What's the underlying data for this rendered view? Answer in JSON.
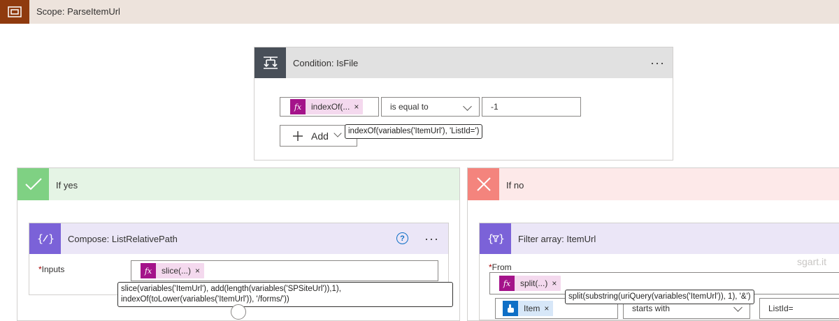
{
  "scope": {
    "title": "Scope: ParseItemUrl"
  },
  "condition": {
    "title": "Condition: IsFile",
    "menu": "···",
    "left_token": "indexOf(...",
    "operator": "is equal to",
    "value": "-1",
    "add_label": "Add",
    "tooltip": "indexOf(variables('ItemUrl'), 'ListId=')"
  },
  "if_yes": {
    "label": "If yes",
    "action": {
      "title": "Compose: ListRelativePath",
      "help": "?",
      "menu": "···",
      "inputs_label": "Inputs",
      "token": "slice(...)",
      "tooltip_line1": "slice(variables('ItemUrl'), add(length(variables('SPSiteUrl')),1),",
      "tooltip_line2": "indexOf(toLower(variables('ItemUrl')), '/forms/'))"
    }
  },
  "if_no": {
    "label": "If no",
    "action": {
      "title": "Filter array: ItemUrl",
      "from_label": "From",
      "token": "split(...)",
      "tooltip": "split(substring(uriQuery(variables('ItemUrl')), 1), '&')",
      "item_token": "Item",
      "operator": "starts with",
      "value": "ListId="
    }
  },
  "watermark": "sgart.it",
  "fx_symbol": "fx",
  "close_symbol": "×",
  "required_marker": "*"
}
